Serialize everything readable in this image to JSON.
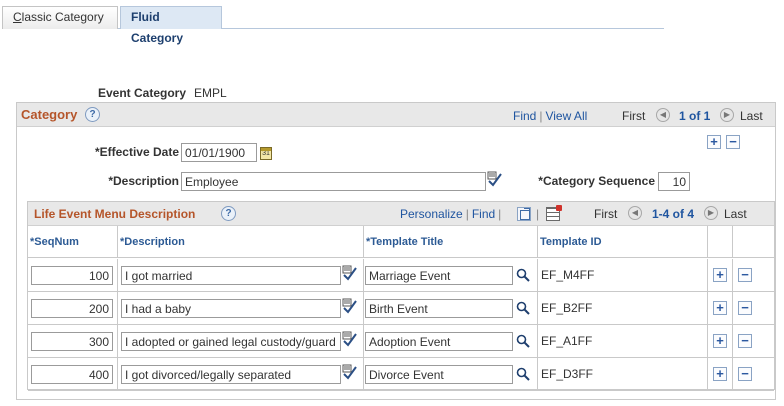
{
  "tabs": {
    "classic_prefix": "C",
    "classic_rest": "lassic Category",
    "fluid": "Fluid Category"
  },
  "event_category": {
    "label": "Event Category",
    "value": "EMPL"
  },
  "category": {
    "title": "Category",
    "find": "Find",
    "view_all": "View All",
    "first": "First",
    "count": "1 of 1",
    "last": "Last",
    "effective_date_label": "*Effective Date",
    "effective_date_value": "01/01/1900",
    "description_label": "*Description",
    "description_value": "Employee",
    "sequence_label": "*Category Sequence",
    "sequence_value": "10"
  },
  "grid": {
    "title": "Life Event Menu Description",
    "personalize": "Personalize",
    "find": "Find",
    "first": "First",
    "count": "1-4 of 4",
    "last": "Last",
    "columns": {
      "seq": "*SeqNum",
      "desc": "*Description",
      "template": "*Template Title",
      "template_id": "Template ID"
    },
    "rows": [
      {
        "seq": "100",
        "desc": "I got married",
        "template": "Marriage Event",
        "template_id": "EF_M4FF"
      },
      {
        "seq": "200",
        "desc": "I had a baby",
        "template": "Birth Event",
        "template_id": "EF_B2FF"
      },
      {
        "seq": "300",
        "desc": "I adopted or gained legal custody/guard",
        "template": "Adoption Event",
        "template_id": "EF_A1FF"
      },
      {
        "seq": "400",
        "desc": "I got divorced/legally separated",
        "template": "Divorce Event",
        "template_id": "EF_D3FF"
      }
    ]
  },
  "icons": {
    "help": "?",
    "add": "+",
    "delete": "−",
    "prev": "◀",
    "next": "▶",
    "calendar": "31"
  },
  "colors": {
    "section_title": "#b5552a",
    "link": "#1f55a0",
    "header_bg": "#e8e8e8"
  }
}
